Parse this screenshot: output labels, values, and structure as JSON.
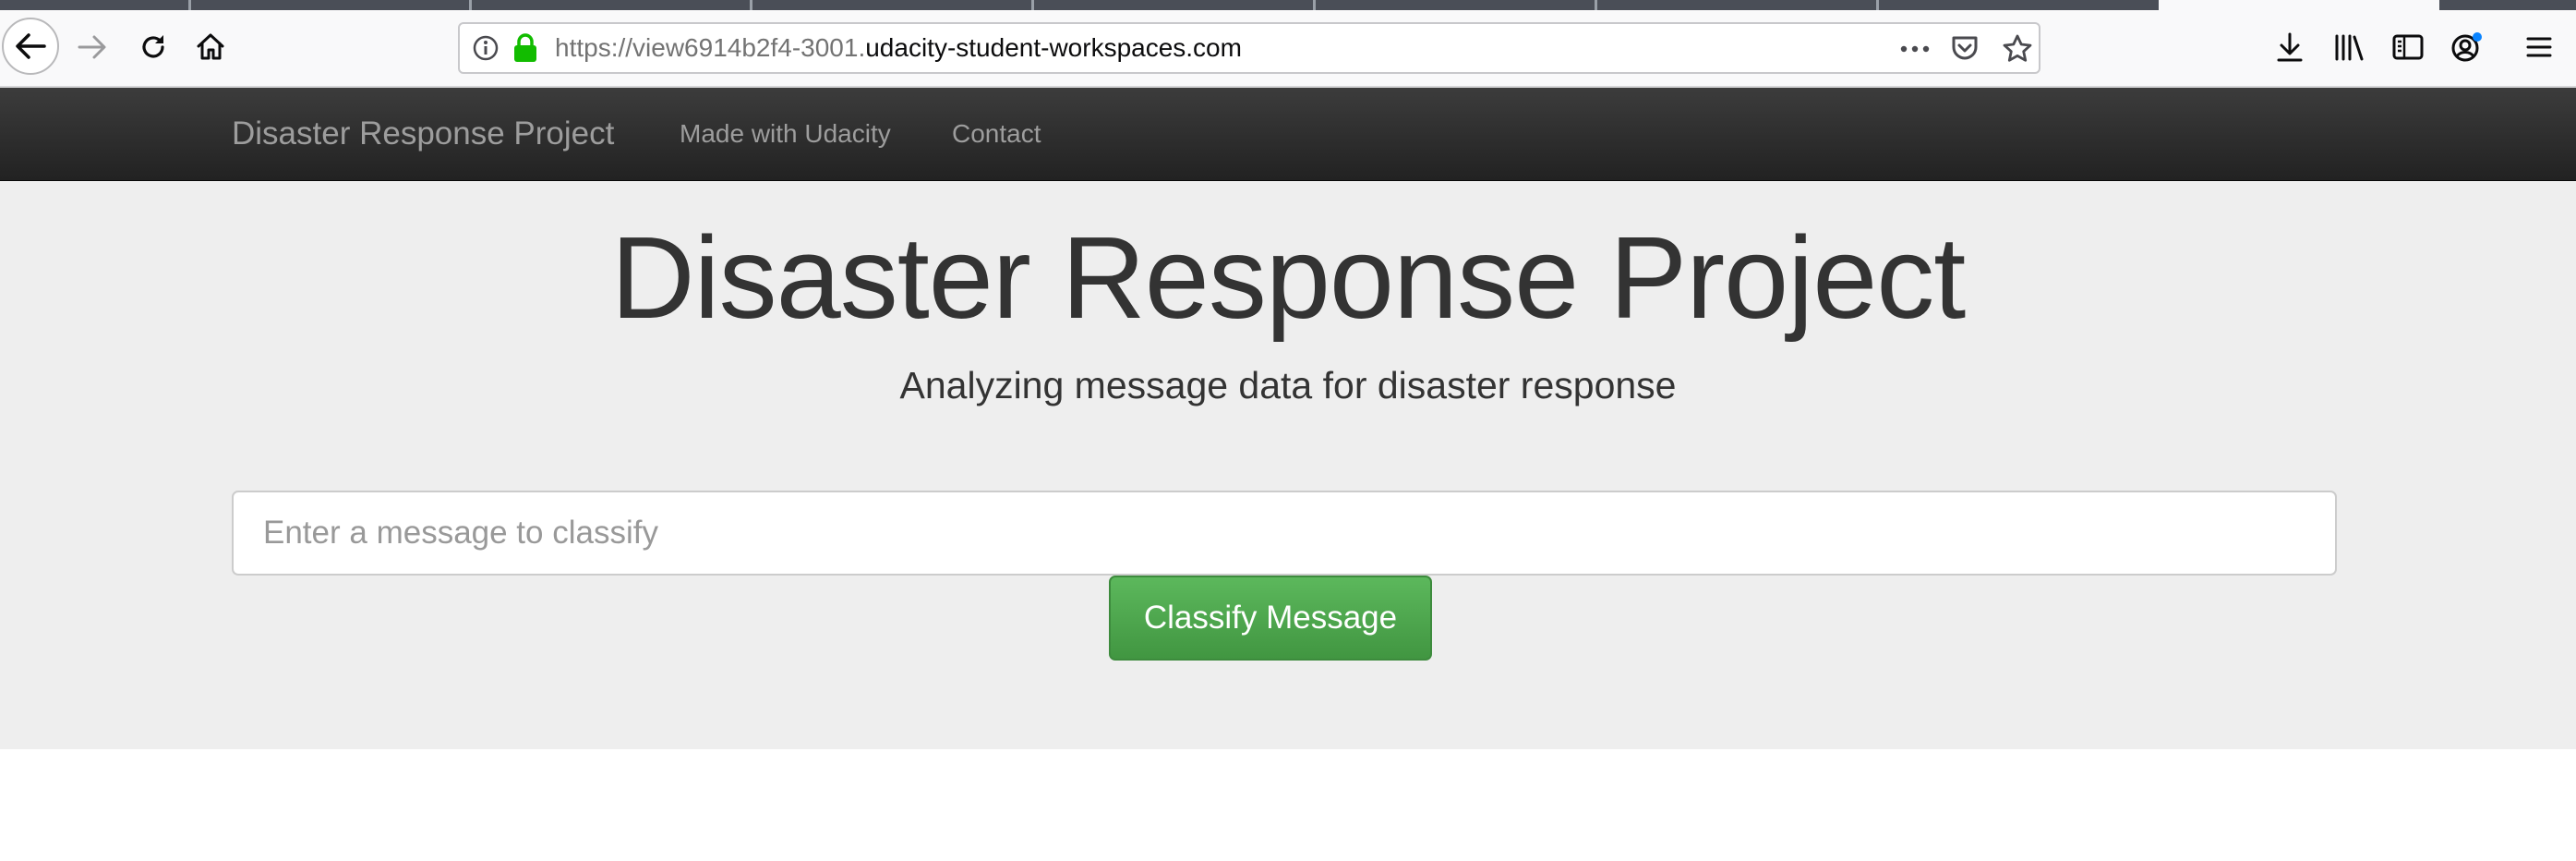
{
  "browser": {
    "url_prefix": "https://view6914b2f4-3001.",
    "url_domain": "udacity-student-workspaces.com"
  },
  "navbar": {
    "brand": "Disaster Response Project",
    "links": [
      "Made with Udacity",
      "Contact"
    ]
  },
  "jumbotron": {
    "title": "Disaster Response Project",
    "lead": "Analyzing message data for disaster response",
    "input_placeholder": "Enter a message to classify",
    "button_label": "Classify Message"
  },
  "colors": {
    "navbar": "#222222",
    "jumbotron": "#eeeeee",
    "button": "#5cb85c",
    "lock": "#12bc00"
  }
}
